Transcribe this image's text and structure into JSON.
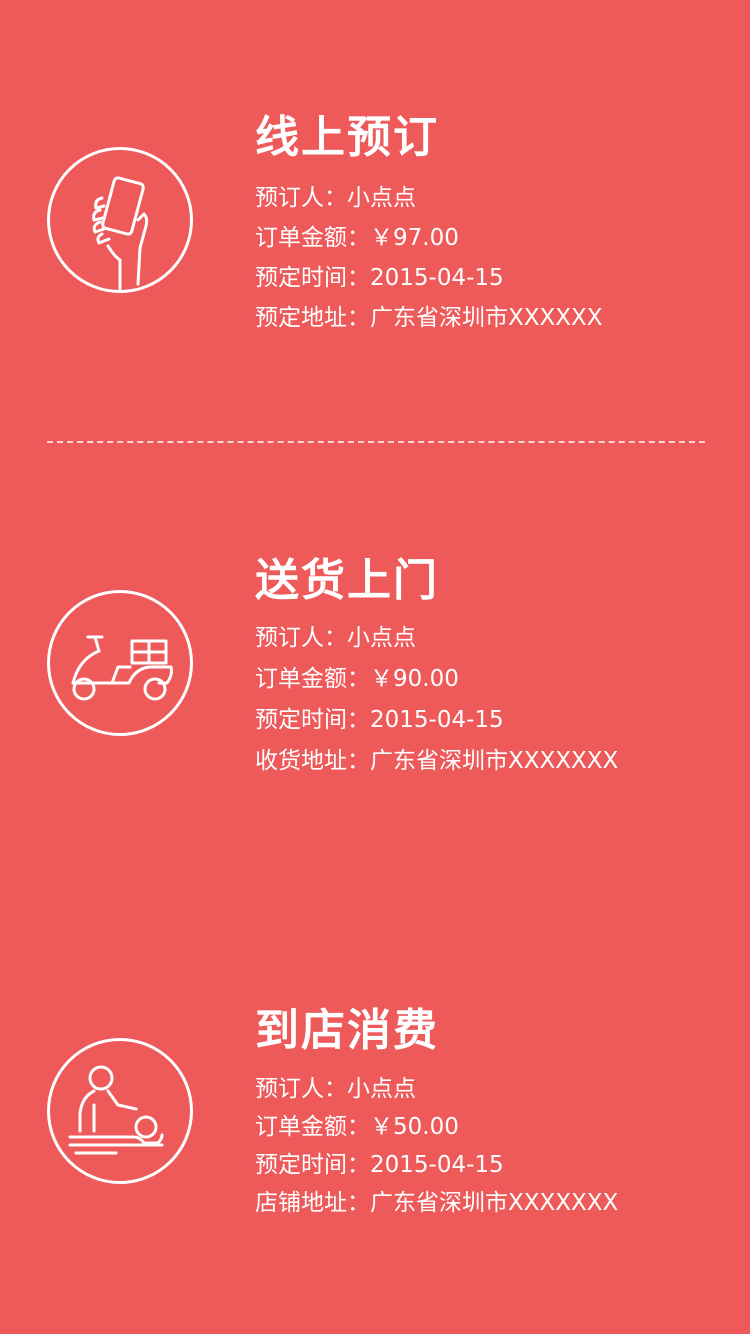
{
  "sections": [
    {
      "title": "线上预订",
      "icon": "hand-phone-icon",
      "lines": [
        {
          "label": "预订人：",
          "value": "小点点"
        },
        {
          "label": "订单金额：",
          "value": "￥97.00"
        },
        {
          "label": "预定时间：",
          "value": "2015-04-15"
        },
        {
          "label": "预定地址：",
          "value": "广东省深圳市XXXXXX"
        }
      ]
    },
    {
      "title": "送货上门",
      "icon": "scooter-icon",
      "lines": [
        {
          "label": "预订人：",
          "value": "小点点"
        },
        {
          "label": "订单金额：",
          "value": "￥90.00"
        },
        {
          "label": "预定时间：",
          "value": "2015-04-15"
        },
        {
          "label": "收货地址：",
          "value": "广东省深圳市XXXXXXX"
        }
      ]
    },
    {
      "title": "到店消费",
      "icon": "massage-icon",
      "lines": [
        {
          "label": "预订人：",
          "value": "小点点"
        },
        {
          "label": "订单金额：",
          "value": "￥50.00"
        },
        {
          "label": "预定时间：",
          "value": "2015-04-15"
        },
        {
          "label": "店铺地址：",
          "value": "广东省深圳市XXXXXXX"
        }
      ]
    }
  ],
  "colors": {
    "background": "#ee595a",
    "foreground": "#ffffff"
  }
}
